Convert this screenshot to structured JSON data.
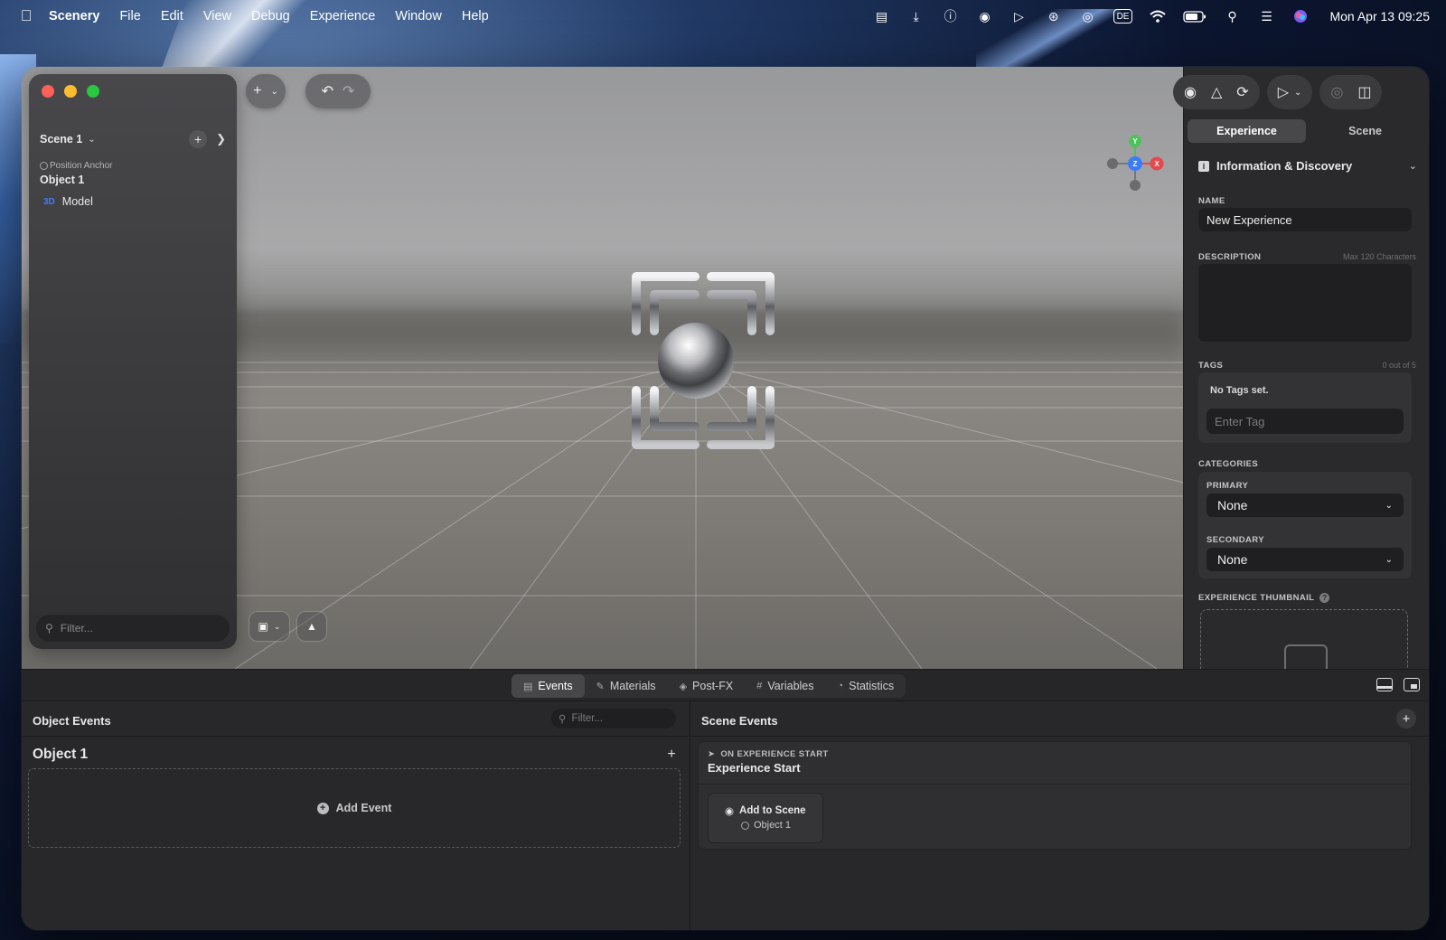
{
  "menubar": {
    "app_name": "Scenery",
    "menus": [
      "File",
      "Edit",
      "View",
      "Debug",
      "Experience",
      "Window",
      "Help"
    ],
    "clock": "Mon Apr 13  09:25",
    "keyboard_layout": "DE",
    "status_icons": [
      "message-icon",
      "download-icon",
      "one-password-icon",
      "fingerprint-icon",
      "play-circle-icon",
      "airdrop-icon",
      "screen-record-icon",
      "keyboard-layout-icon",
      "wifi-icon",
      "battery-icon",
      "search-icon",
      "control-center-icon",
      "siri-icon"
    ]
  },
  "sidebar": {
    "scene_name": "Scene 1",
    "anchor_label": "Position Anchor",
    "object_name": "Object 1",
    "model_badge": "3D",
    "model_label": "Model",
    "filter_placeholder": "Filter..."
  },
  "inspector": {
    "tabs": [
      "Experience",
      "Scene"
    ],
    "active_tab": "Experience",
    "section_title": "Information & Discovery",
    "name_label": "NAME",
    "name_value": "New Experience",
    "description_label": "DESCRIPTION",
    "description_hint": "Max 120 Characters",
    "tags_label": "TAGS",
    "tags_count": "0 out of 5",
    "no_tags_text": "No Tags set.",
    "tag_placeholder": "Enter Tag",
    "categories_label": "CATEGORIES",
    "primary_label": "PRIMARY",
    "primary_value": "None",
    "secondary_label": "SECONDARY",
    "secondary_value": "None",
    "thumbnail_label": "EXPERIENCE THUMBNAIL"
  },
  "bottom_tabs": [
    {
      "label": "Events",
      "icon": "events-icon",
      "active": true
    },
    {
      "label": "Materials",
      "icon": "brush-icon",
      "active": false
    },
    {
      "label": "Post-FX",
      "icon": "fx-icon",
      "active": false
    },
    {
      "label": "Variables",
      "icon": "hash-icon",
      "active": false
    },
    {
      "label": "Statistics",
      "icon": "pie-chart-icon",
      "active": false
    }
  ],
  "object_events": {
    "title": "Object Events",
    "filter_placeholder": "Filter...",
    "object_name": "Object 1",
    "add_event_label": "Add Event"
  },
  "scene_events": {
    "title": "Scene Events",
    "event_type": "ON EXPERIENCE START",
    "event_name": "Experience Start",
    "action_title": "Add to Scene",
    "action_target": "Object 1"
  },
  "gizmo": {
    "y_label": "Y",
    "x_label": "X",
    "z_label": "Z"
  },
  "colors": {
    "traffic_red": "#fe5f57",
    "traffic_yellow": "#febc2e",
    "traffic_green": "#28c840",
    "gizmo_y": "#4cc35a",
    "gizmo_x": "#e5484d",
    "gizmo_z": "#3b7bff"
  }
}
